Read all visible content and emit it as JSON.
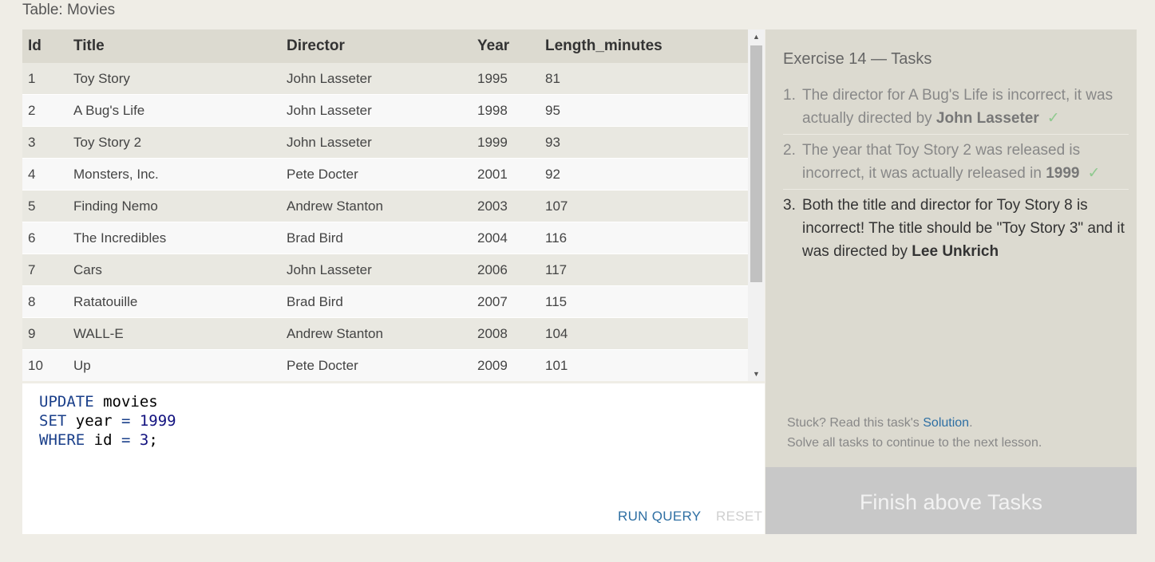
{
  "table_caption": "Table: Movies",
  "columns": [
    "Id",
    "Title",
    "Director",
    "Year",
    "Length_minutes"
  ],
  "rows": [
    [
      "1",
      "Toy Story",
      "John Lasseter",
      "1995",
      "81"
    ],
    [
      "2",
      "A Bug's Life",
      "John Lasseter",
      "1998",
      "95"
    ],
    [
      "3",
      "Toy Story 2",
      "John Lasseter",
      "1999",
      "93"
    ],
    [
      "4",
      "Monsters, Inc.",
      "Pete Docter",
      "2001",
      "92"
    ],
    [
      "5",
      "Finding Nemo",
      "Andrew Stanton",
      "2003",
      "107"
    ],
    [
      "6",
      "The Incredibles",
      "Brad Bird",
      "2004",
      "116"
    ],
    [
      "7",
      "Cars",
      "John Lasseter",
      "2006",
      "117"
    ],
    [
      "8",
      "Ratatouille",
      "Brad Bird",
      "2007",
      "115"
    ],
    [
      "9",
      "WALL-E",
      "Andrew Stanton",
      "2008",
      "104"
    ],
    [
      "10",
      "Up",
      "Pete Docter",
      "2009",
      "101"
    ]
  ],
  "scrollbar": {
    "up_icon": "triangle-up-icon",
    "down_icon": "triangle-down-icon"
  },
  "editor": {
    "line1_kw": "UPDATE",
    "line1_rest": " movies",
    "line2_kw": "SET",
    "line2_mid": " year ",
    "line2_op": "=",
    "line2_num": " 1999",
    "line3_kw": "WHERE",
    "line3_mid": " id ",
    "line3_op": "=",
    "line3_num": " 3",
    "line3_end": ";",
    "run_label": "RUN QUERY",
    "reset_label": "RESET"
  },
  "tasks": {
    "title": "Exercise 14 — Tasks",
    "items": [
      {
        "num": "1.",
        "text_before": "The director for A Bug's Life is incorrect, it was actually directed by ",
        "bold": "John Lasseter",
        "text_after": "",
        "check": "✓"
      },
      {
        "num": "2.",
        "text_before": "The year that Toy Story 2 was released is incorrect, it was actually released in ",
        "bold": "1999",
        "text_after": "",
        "check": "✓"
      },
      {
        "num": "3.",
        "text_before": "Both the title and director for Toy Story 8 is incorrect! The title should be \"Toy Story 3\" and it was directed by ",
        "bold": "Lee Unkrich",
        "text_after": "",
        "check": ""
      }
    ],
    "help_prefix": "Stuck? Read this task's ",
    "help_link": "Solution",
    "help_suffix": ".",
    "help_line2": "Solve all tasks to continue to the next lesson.",
    "finish_label": "Finish above Tasks"
  },
  "colors": {
    "background": "#efede6",
    "header_bg": "#dcdad0",
    "link": "#2e6fa3",
    "check": "#8fc98f",
    "finish_bg": "#c8c8c8"
  }
}
